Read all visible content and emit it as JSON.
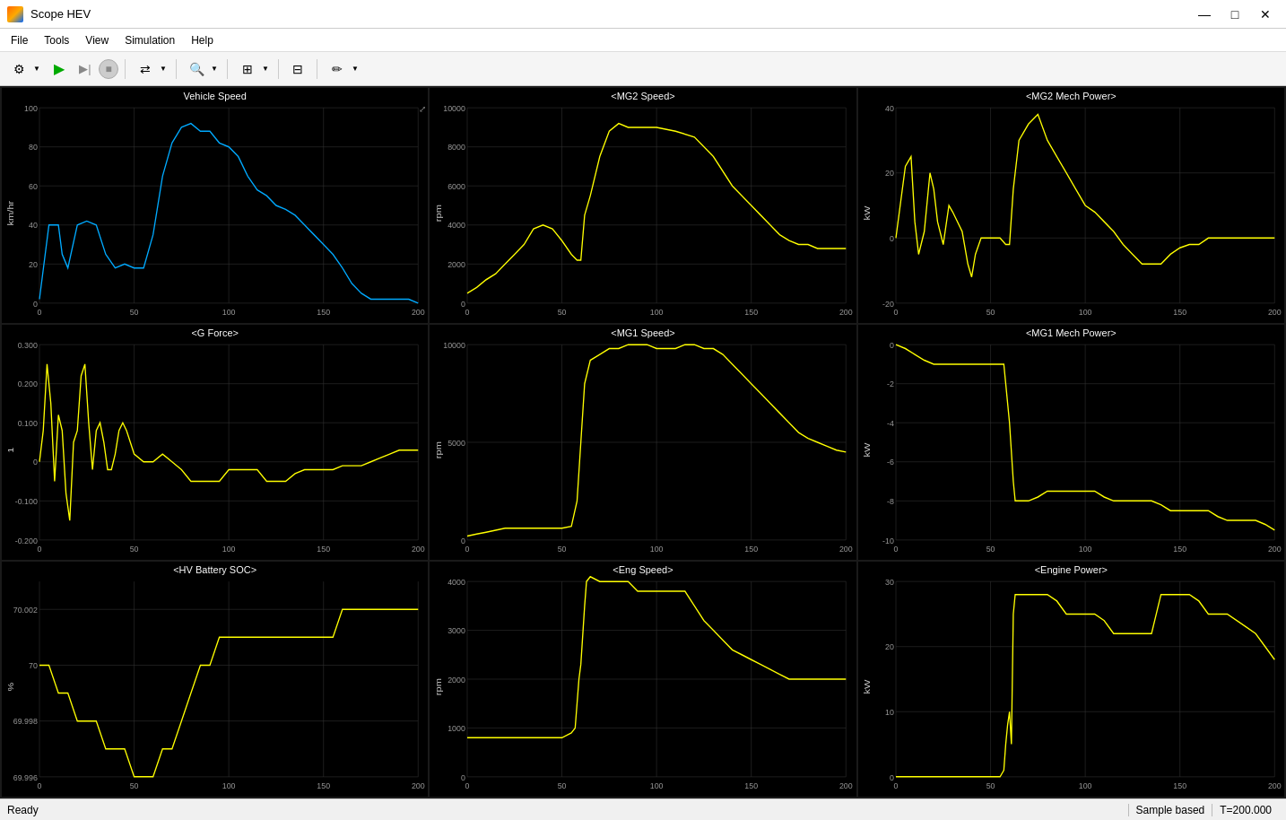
{
  "window": {
    "title": "Scope HEV",
    "controls": {
      "minimize": "—",
      "maximize": "□",
      "close": "✕"
    }
  },
  "menubar": {
    "items": [
      "File",
      "Tools",
      "View",
      "Simulation",
      "Help"
    ]
  },
  "toolbar": {
    "groups": [
      {
        "buttons": [
          "⚙",
          "▶",
          "⏹"
        ]
      },
      {
        "buttons": [
          "🔄"
        ]
      },
      {
        "buttons": [
          "🔍"
        ]
      },
      {
        "buttons": [
          "⊞"
        ]
      },
      {
        "buttons": [
          "⇄"
        ]
      },
      {
        "buttons": [
          "✏"
        ]
      }
    ]
  },
  "charts": [
    {
      "id": "vehicle-speed",
      "title": "Vehicle Speed",
      "ylabel": "km/hr",
      "ymin": 0,
      "ymax": 100,
      "yticks": [
        0,
        20,
        40,
        60,
        80,
        100
      ],
      "xmin": 0,
      "xmax": 200,
      "xticks": [
        0,
        50,
        100,
        150,
        200
      ],
      "color": "#00aaff",
      "type": "vehicle-speed"
    },
    {
      "id": "mg2-speed",
      "title": "<MG2 Speed>",
      "ylabel": "rpm",
      "ymin": 0,
      "ymax": 10000,
      "yticks": [
        0,
        2000,
        4000,
        6000,
        8000,
        10000
      ],
      "xmin": 0,
      "xmax": 200,
      "xticks": [
        0,
        50,
        100,
        150,
        200
      ],
      "color": "#ffff00",
      "type": "mg2-speed"
    },
    {
      "id": "mg2-mech-power",
      "title": "<MG2 Mech Power>",
      "ylabel": "kW",
      "ymin": -20,
      "ymax": 40,
      "yticks": [
        -20,
        0,
        20,
        40
      ],
      "xmin": 0,
      "xmax": 200,
      "xticks": [
        0,
        50,
        100,
        150,
        200
      ],
      "color": "#ffff00",
      "type": "mg2-mech-power"
    },
    {
      "id": "g-force",
      "title": "<G Force>",
      "ylabel": "1",
      "ymin": -0.2,
      "ymax": 0.3,
      "yticks": [
        -0.2,
        -0.1,
        0,
        0.1,
        0.2,
        0.3
      ],
      "xmin": 0,
      "xmax": 200,
      "xticks": [
        0,
        50,
        100,
        150,
        200
      ],
      "color": "#ffff00",
      "type": "g-force"
    },
    {
      "id": "mg1-speed",
      "title": "<MG1 Speed>",
      "ylabel": "rpm",
      "ymin": 0,
      "ymax": 10000,
      "yticks": [
        0,
        5000,
        10000
      ],
      "xmin": 0,
      "xmax": 200,
      "xticks": [
        0,
        50,
        100,
        150,
        200
      ],
      "color": "#ffff00",
      "type": "mg1-speed"
    },
    {
      "id": "mg1-mech-power",
      "title": "<MG1 Mech Power>",
      "ylabel": "kW",
      "ymin": -10,
      "ymax": 0,
      "yticks": [
        -10,
        -8,
        -6,
        -4,
        -2,
        0
      ],
      "xmin": 0,
      "xmax": 200,
      "xticks": [
        0,
        50,
        100,
        150,
        200
      ],
      "color": "#ffff00",
      "type": "mg1-mech-power"
    },
    {
      "id": "hv-battery-soc",
      "title": "<HV Battery SOC>",
      "ylabel": "%",
      "ymin": 69.996,
      "ymax": 70.003,
      "yticks": [
        69.996,
        69.998,
        70.0,
        70.002
      ],
      "xmin": 0,
      "xmax": 200,
      "xticks": [
        0,
        50,
        100,
        150,
        200
      ],
      "color": "#ffff00",
      "type": "hv-battery-soc"
    },
    {
      "id": "eng-speed",
      "title": "<Eng Speed>",
      "ylabel": "rpm",
      "ymin": 0,
      "ymax": 4000,
      "yticks": [
        0,
        1000,
        2000,
        3000,
        4000
      ],
      "xmin": 0,
      "xmax": 200,
      "xticks": [
        0,
        50,
        100,
        150,
        200
      ],
      "color": "#ffff00",
      "type": "eng-speed"
    },
    {
      "id": "engine-power",
      "title": "<Engine Power>",
      "ylabel": "kW",
      "ymin": 0,
      "ymax": 30,
      "yticks": [
        0,
        10,
        20,
        30
      ],
      "xmin": 0,
      "xmax": 200,
      "xticks": [
        0,
        50,
        100,
        150,
        200
      ],
      "color": "#ffff00",
      "type": "engine-power"
    }
  ],
  "statusbar": {
    "left": "Ready",
    "sample_based": "Sample based",
    "time": "T=200.000"
  }
}
